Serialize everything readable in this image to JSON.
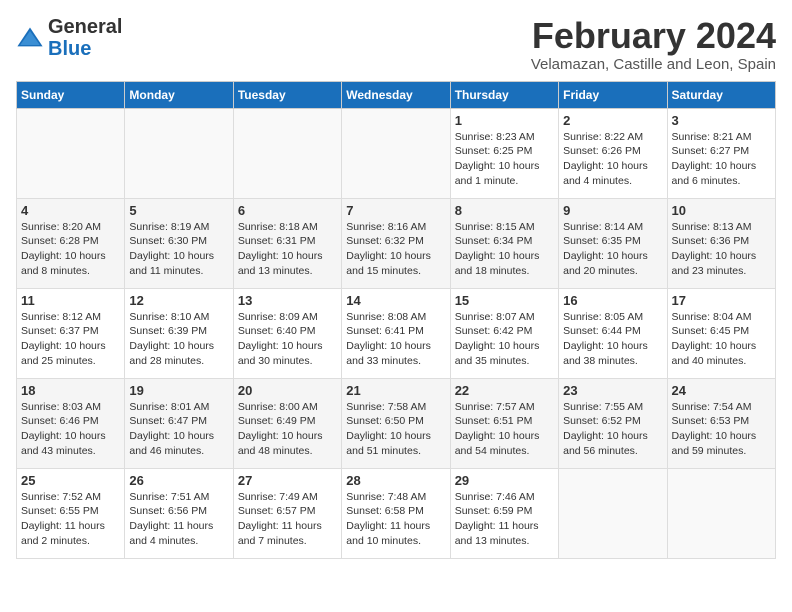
{
  "logo": {
    "general": "General",
    "blue": "Blue"
  },
  "title": "February 2024",
  "location": "Velamazan, Castille and Leon, Spain",
  "days_of_week": [
    "Sunday",
    "Monday",
    "Tuesday",
    "Wednesday",
    "Thursday",
    "Friday",
    "Saturday"
  ],
  "weeks": [
    [
      {
        "day": "",
        "info": ""
      },
      {
        "day": "",
        "info": ""
      },
      {
        "day": "",
        "info": ""
      },
      {
        "day": "",
        "info": ""
      },
      {
        "day": "1",
        "info": "Sunrise: 8:23 AM\nSunset: 6:25 PM\nDaylight: 10 hours\nand 1 minute."
      },
      {
        "day": "2",
        "info": "Sunrise: 8:22 AM\nSunset: 6:26 PM\nDaylight: 10 hours\nand 4 minutes."
      },
      {
        "day": "3",
        "info": "Sunrise: 8:21 AM\nSunset: 6:27 PM\nDaylight: 10 hours\nand 6 minutes."
      }
    ],
    [
      {
        "day": "4",
        "info": "Sunrise: 8:20 AM\nSunset: 6:28 PM\nDaylight: 10 hours\nand 8 minutes."
      },
      {
        "day": "5",
        "info": "Sunrise: 8:19 AM\nSunset: 6:30 PM\nDaylight: 10 hours\nand 11 minutes."
      },
      {
        "day": "6",
        "info": "Sunrise: 8:18 AM\nSunset: 6:31 PM\nDaylight: 10 hours\nand 13 minutes."
      },
      {
        "day": "7",
        "info": "Sunrise: 8:16 AM\nSunset: 6:32 PM\nDaylight: 10 hours\nand 15 minutes."
      },
      {
        "day": "8",
        "info": "Sunrise: 8:15 AM\nSunset: 6:34 PM\nDaylight: 10 hours\nand 18 minutes."
      },
      {
        "day": "9",
        "info": "Sunrise: 8:14 AM\nSunset: 6:35 PM\nDaylight: 10 hours\nand 20 minutes."
      },
      {
        "day": "10",
        "info": "Sunrise: 8:13 AM\nSunset: 6:36 PM\nDaylight: 10 hours\nand 23 minutes."
      }
    ],
    [
      {
        "day": "11",
        "info": "Sunrise: 8:12 AM\nSunset: 6:37 PM\nDaylight: 10 hours\nand 25 minutes."
      },
      {
        "day": "12",
        "info": "Sunrise: 8:10 AM\nSunset: 6:39 PM\nDaylight: 10 hours\nand 28 minutes."
      },
      {
        "day": "13",
        "info": "Sunrise: 8:09 AM\nSunset: 6:40 PM\nDaylight: 10 hours\nand 30 minutes."
      },
      {
        "day": "14",
        "info": "Sunrise: 8:08 AM\nSunset: 6:41 PM\nDaylight: 10 hours\nand 33 minutes."
      },
      {
        "day": "15",
        "info": "Sunrise: 8:07 AM\nSunset: 6:42 PM\nDaylight: 10 hours\nand 35 minutes."
      },
      {
        "day": "16",
        "info": "Sunrise: 8:05 AM\nSunset: 6:44 PM\nDaylight: 10 hours\nand 38 minutes."
      },
      {
        "day": "17",
        "info": "Sunrise: 8:04 AM\nSunset: 6:45 PM\nDaylight: 10 hours\nand 40 minutes."
      }
    ],
    [
      {
        "day": "18",
        "info": "Sunrise: 8:03 AM\nSunset: 6:46 PM\nDaylight: 10 hours\nand 43 minutes."
      },
      {
        "day": "19",
        "info": "Sunrise: 8:01 AM\nSunset: 6:47 PM\nDaylight: 10 hours\nand 46 minutes."
      },
      {
        "day": "20",
        "info": "Sunrise: 8:00 AM\nSunset: 6:49 PM\nDaylight: 10 hours\nand 48 minutes."
      },
      {
        "day": "21",
        "info": "Sunrise: 7:58 AM\nSunset: 6:50 PM\nDaylight: 10 hours\nand 51 minutes."
      },
      {
        "day": "22",
        "info": "Sunrise: 7:57 AM\nSunset: 6:51 PM\nDaylight: 10 hours\nand 54 minutes."
      },
      {
        "day": "23",
        "info": "Sunrise: 7:55 AM\nSunset: 6:52 PM\nDaylight: 10 hours\nand 56 minutes."
      },
      {
        "day": "24",
        "info": "Sunrise: 7:54 AM\nSunset: 6:53 PM\nDaylight: 10 hours\nand 59 minutes."
      }
    ],
    [
      {
        "day": "25",
        "info": "Sunrise: 7:52 AM\nSunset: 6:55 PM\nDaylight: 11 hours\nand 2 minutes."
      },
      {
        "day": "26",
        "info": "Sunrise: 7:51 AM\nSunset: 6:56 PM\nDaylight: 11 hours\nand 4 minutes."
      },
      {
        "day": "27",
        "info": "Sunrise: 7:49 AM\nSunset: 6:57 PM\nDaylight: 11 hours\nand 7 minutes."
      },
      {
        "day": "28",
        "info": "Sunrise: 7:48 AM\nSunset: 6:58 PM\nDaylight: 11 hours\nand 10 minutes."
      },
      {
        "day": "29",
        "info": "Sunrise: 7:46 AM\nSunset: 6:59 PM\nDaylight: 11 hours\nand 13 minutes."
      },
      {
        "day": "",
        "info": ""
      },
      {
        "day": "",
        "info": ""
      }
    ]
  ]
}
